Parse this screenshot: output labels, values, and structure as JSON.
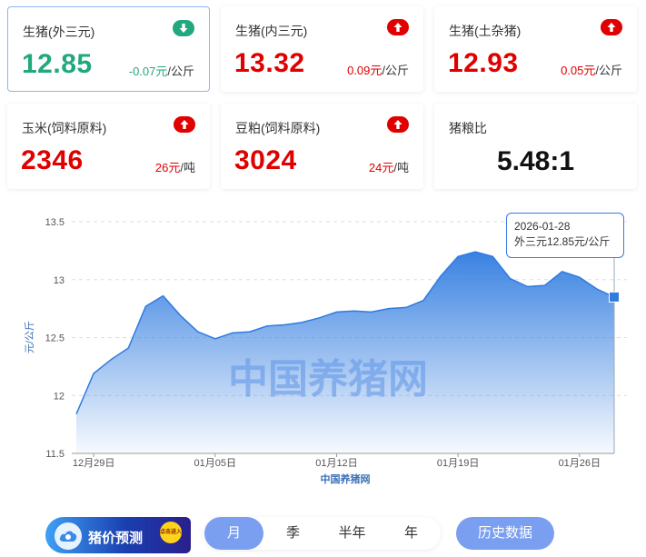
{
  "cards": [
    {
      "label": "生猪(外三元)",
      "value": "12.85",
      "change": "-0.07元",
      "unit": "/公斤",
      "trend": "down",
      "icon": "arrow-down-icon"
    },
    {
      "label": "生猪(内三元)",
      "value": "13.32",
      "change": "0.09元",
      "unit": "/公斤",
      "trend": "up",
      "icon": "arrow-up-icon"
    },
    {
      "label": "生猪(土杂猪)",
      "value": "12.93",
      "change": "0.05元",
      "unit": "/公斤",
      "trend": "up",
      "icon": "arrow-up-icon"
    },
    {
      "label": "玉米(饲料原料)",
      "value": "2346",
      "change": "26元",
      "unit": "/吨",
      "trend": "up",
      "icon": "arrow-up-icon"
    },
    {
      "label": "豆粕(饲料原料)",
      "value": "3024",
      "change": "24元",
      "unit": "/吨",
      "trend": "up",
      "icon": "arrow-up-icon"
    },
    {
      "label": "猪粮比",
      "value": "5.48:1"
    }
  ],
  "colors": {
    "up": "#e00000",
    "down": "#21a87f",
    "accent": "#3a7be0",
    "button": "#7b9ff0"
  },
  "tooltip": {
    "date": "2026-01-28",
    "text": "外三元12.85元/公斤"
  },
  "watermark": "中国养猪网",
  "chart_data": {
    "type": "area",
    "ylabel": "元/公斤",
    "xlabel": "中国养猪网",
    "ylim": [
      11.5,
      13.5
    ],
    "yticks": [
      "13.5",
      "13",
      "12.5",
      "12",
      "11.5"
    ],
    "grid": "horizontal dashed",
    "x": [
      "12月28日",
      "12月29日",
      "12月30日",
      "12月31日",
      "01月01日",
      "01月02日",
      "01月03日",
      "01月04日",
      "01月05日",
      "01月06日",
      "01月07日",
      "01月08日",
      "01月09日",
      "01月10日",
      "01月11日",
      "01月12日",
      "01月13日",
      "01月14日",
      "01月15日",
      "01月16日",
      "01月17日",
      "01月18日",
      "01月19日",
      "01月20日",
      "01月21日",
      "01月22日",
      "01月23日",
      "01月24日",
      "01月25日",
      "01月26日",
      "01月27日",
      "01月28日"
    ],
    "xtick_labels": [
      "12月29日",
      "01月05日",
      "01月12日",
      "01月19日",
      "01月26日"
    ],
    "series": [
      {
        "values": [
          11.84,
          12.19,
          12.31,
          12.41,
          12.77,
          12.86,
          12.69,
          12.55,
          12.49,
          12.54,
          12.55,
          12.6,
          12.61,
          12.63,
          12.67,
          12.72,
          12.73,
          12.72,
          12.75,
          12.76,
          12.82,
          13.03,
          13.2,
          13.24,
          13.2,
          13.01,
          12.94,
          12.95,
          13.07,
          13.02,
          12.92,
          12.85
        ]
      }
    ]
  },
  "controls": {
    "promo_text": "猪价预测",
    "promo_badge": "点击进入",
    "tabs": [
      "月",
      "季",
      "半年",
      "年"
    ],
    "active_tab": "月",
    "history_button": "历史数据"
  }
}
